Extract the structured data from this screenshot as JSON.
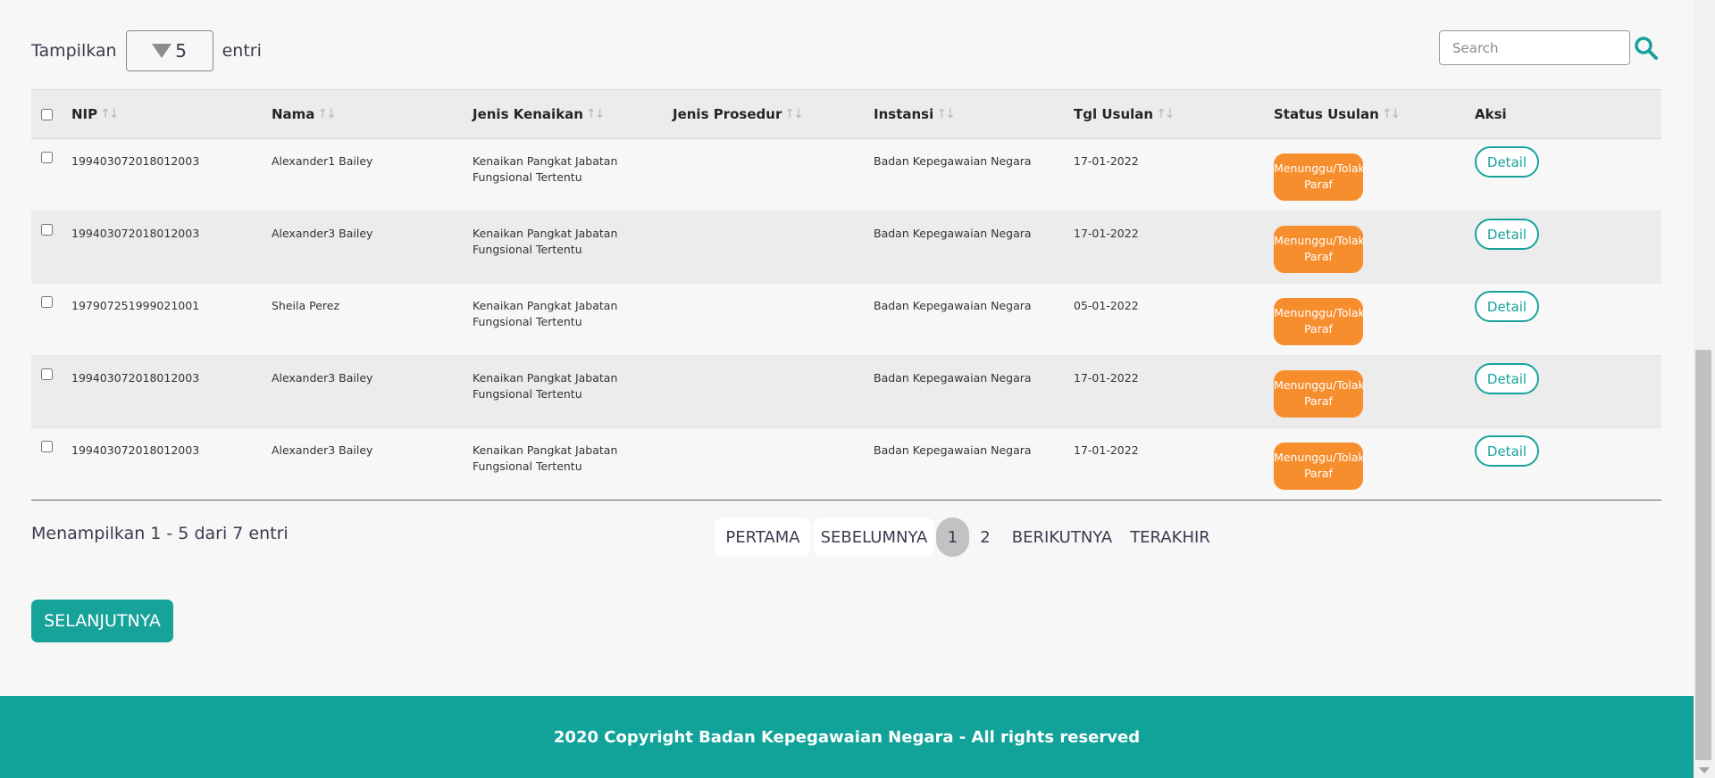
{
  "controls": {
    "show_label": "Tampilkan",
    "entries_value": "5",
    "entries_label": "entri",
    "search_placeholder": "Search"
  },
  "table": {
    "headers": [
      {
        "label": "NIP",
        "sortable": true
      },
      {
        "label": "Nama",
        "sortable": true
      },
      {
        "label": "Jenis Kenaikan",
        "sortable": true
      },
      {
        "label": "Jenis Prosedur",
        "sortable": true
      },
      {
        "label": "Instansi",
        "sortable": true
      },
      {
        "label": "Tgl Usulan",
        "sortable": true
      },
      {
        "label": "Status Usulan",
        "sortable": true
      },
      {
        "label": "Aksi",
        "sortable": false
      }
    ],
    "sort_glyph": "↑↓",
    "rows": [
      {
        "nip": "199403072018012003",
        "nama": "Alexander1 Bailey",
        "jenis_kenaikan_1": "Kenaikan Pangkat Jabatan",
        "jenis_kenaikan_2": "Fungsional Tertentu",
        "jenis_prosedur": "",
        "instansi": "Badan Kepegawaian Negara",
        "tgl": "17-01-2022",
        "status_1": "Menunggu/Tolak",
        "status_2": "Paraf",
        "aksi": "Detail"
      },
      {
        "nip": "199403072018012003",
        "nama": "Alexander3 Bailey",
        "jenis_kenaikan_1": "Kenaikan Pangkat Jabatan",
        "jenis_kenaikan_2": "Fungsional Tertentu",
        "jenis_prosedur": "",
        "instansi": "Badan Kepegawaian Negara",
        "tgl": "17-01-2022",
        "status_1": "Menunggu/Tolak",
        "status_2": "Paraf",
        "aksi": "Detail"
      },
      {
        "nip": "197907251999021001",
        "nama": "Sheila Perez",
        "jenis_kenaikan_1": "Kenaikan Pangkat Jabatan",
        "jenis_kenaikan_2": "Fungsional Tertentu",
        "jenis_prosedur": "",
        "instansi": "Badan Kepegawaian Negara",
        "tgl": "05-01-2022",
        "status_1": "Menunggu/Tolak",
        "status_2": "Paraf",
        "aksi": "Detail"
      },
      {
        "nip": "199403072018012003",
        "nama": "Alexander3 Bailey",
        "jenis_kenaikan_1": "Kenaikan Pangkat Jabatan",
        "jenis_kenaikan_2": "Fungsional Tertentu",
        "jenis_prosedur": "",
        "instansi": "Badan Kepegawaian Negara",
        "tgl": "17-01-2022",
        "status_1": "Menunggu/Tolak",
        "status_2": "Paraf",
        "aksi": "Detail"
      },
      {
        "nip": "199403072018012003",
        "nama": "Alexander3 Bailey",
        "jenis_kenaikan_1": "Kenaikan Pangkat Jabatan",
        "jenis_kenaikan_2": "Fungsional Tertentu",
        "jenis_prosedur": "",
        "instansi": "Badan Kepegawaian Negara",
        "tgl": "17-01-2022",
        "status_1": "Menunggu/Tolak",
        "status_2": "Paraf",
        "aksi": "Detail"
      }
    ]
  },
  "pagination": {
    "info": "Menampilkan 1 - 5 dari 7 entri",
    "first": "PERTAMA",
    "prev": "SEBELUMNYA",
    "pages": [
      "1",
      "2"
    ],
    "current_page": "1",
    "next": "BERIKUTNYA",
    "last": "TERAKHIR"
  },
  "next_button": "SELANJUTNYA",
  "footer": {
    "copyright": "2020 Copyright Badan Kepegawaian Negara - All rights reserved"
  },
  "colors": {
    "teal": "#11a39a",
    "status_orange": "#f78e2e"
  },
  "icons": {
    "search": "search-icon",
    "length_dropdown": "caret-down-icon"
  }
}
